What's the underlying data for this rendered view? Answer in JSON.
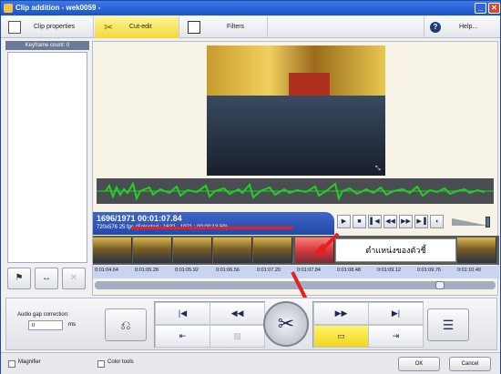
{
  "window": {
    "title": "Clip addition - wek0059 -",
    "minimize_icon": "minimize-icon",
    "close_icon": "close-icon"
  },
  "toolbar": {
    "tabs": [
      {
        "label": "Clip properties",
        "icon": "clip-properties-icon"
      },
      {
        "label": "Cut-edit",
        "icon": "scissors-icon"
      },
      {
        "label": "Filters",
        "icon": "filters-icon"
      }
    ],
    "help_label": "Help..."
  },
  "keyframes": {
    "header": "Keyframe count: 0"
  },
  "timecode": {
    "main": "1696/1971  00:01:07.84",
    "sub": "720x576 25 fps (Selected : 1632 - 1971 : 00:00:13.59)"
  },
  "transport": {
    "buttons": [
      "▶",
      "■",
      "◀◀",
      "◀◀",
      "▶▶",
      "▶▶"
    ]
  },
  "annotation": {
    "thai_text": "ตำแหน่งของตัวชี้"
  },
  "timeline": {
    "ticks": [
      "0:01:04.64",
      "0:01:05.28",
      "0:01:05.92",
      "0:01:06.56",
      "0:01:07.20",
      "0:01:07.84",
      "0:01:08.48",
      "0:01:09.12",
      "0:01:09.76",
      "0:01:10.40"
    ]
  },
  "audio_gap": {
    "label": "Audio gap correction:",
    "value": "0",
    "unit": "ms"
  },
  "footer": {
    "magnifier_label": "Magnifier",
    "color_tools_label": "Color tools",
    "ok_label": "OK",
    "cancel_label": "Cancel"
  },
  "colors": {
    "accent_yellow": "#f3d93a",
    "wave_green": "#22d022",
    "timecode_blue": "#2448a8",
    "pointer_red": "#e62020"
  }
}
